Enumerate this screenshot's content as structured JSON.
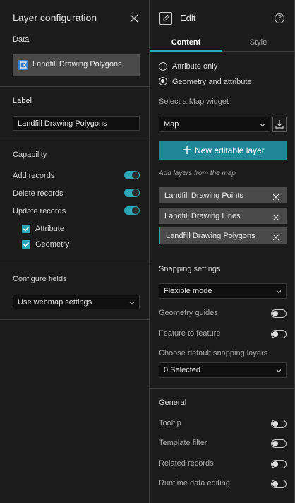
{
  "left": {
    "title": "Layer configuration",
    "data_section": {
      "label": "Data",
      "layer_name": "Landfill Drawing Polygons"
    },
    "label_section": {
      "label": "Label",
      "value": "Landfill Drawing Polygons"
    },
    "capability": {
      "label": "Capability",
      "add": "Add records",
      "delete": "Delete records",
      "update": "Update records",
      "attribute": "Attribute",
      "geometry": "Geometry"
    },
    "configure_fields": {
      "label": "Configure fields",
      "value": "Use webmap settings"
    }
  },
  "right": {
    "title": "Edit",
    "tabs": {
      "content": "Content",
      "style": "Style"
    },
    "radio": {
      "attribute_only": "Attribute only",
      "geometry_attribute": "Geometry and attribute"
    },
    "map_widget": {
      "label": "Select a Map widget",
      "value": "Map"
    },
    "new_layer_button": "New editable layer",
    "add_layers_hint": "Add layers from the map",
    "layers": [
      "Landfill Drawing Points",
      "Landfill Drawing Lines",
      "Landfill Drawing Polygons"
    ],
    "snapping": {
      "title": "Snapping settings",
      "mode": "Flexible mode",
      "geometry_guides": "Geometry guides",
      "feature_to_feature": "Feature to feature",
      "default_layers_label": "Choose default snapping layers",
      "default_layers_value": "0 Selected"
    },
    "general": {
      "title": "General",
      "tooltip": "Tooltip",
      "template_filter": "Template filter",
      "related_records": "Related records",
      "runtime_data_editing": "Runtime data editing"
    }
  },
  "colors": {
    "accent": "#2aa8b8",
    "background": "#1b1b1b",
    "field": "#0f0f0f",
    "chip": "#4a4a4a"
  }
}
